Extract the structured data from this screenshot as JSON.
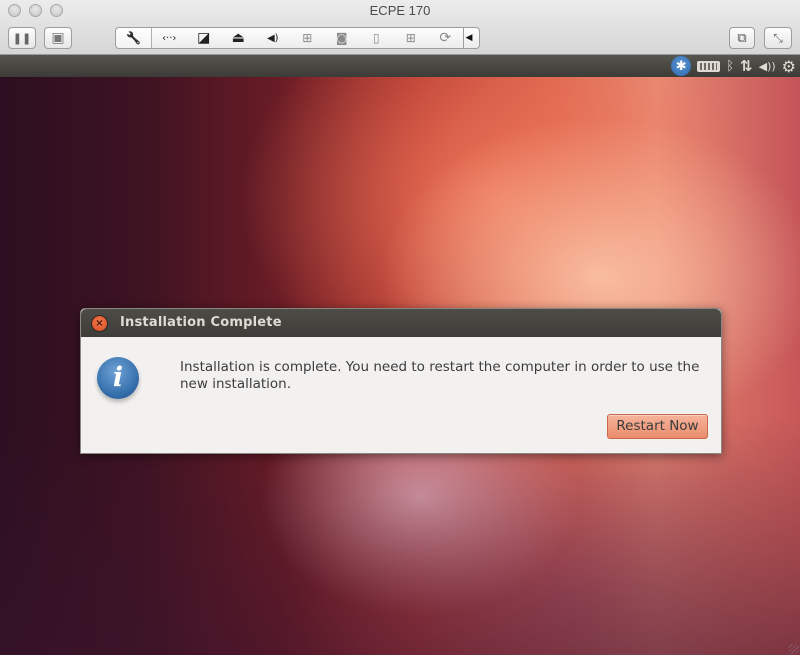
{
  "window": {
    "title": "ECPE 170",
    "traffic_lights": [
      "close",
      "minimize",
      "zoom"
    ]
  },
  "toolbar": {
    "left_buttons": [
      {
        "name": "pause-button",
        "icon": "pause-icon",
        "glyph": "❚❚"
      },
      {
        "name": "snapshot-button",
        "icon": "snapshot-icon",
        "glyph": "▣"
      }
    ],
    "device_group": [
      {
        "name": "settings-button",
        "icon": "wrench-icon",
        "glyph": "🔧",
        "dim": false
      },
      {
        "name": "network-button",
        "icon": "network-icon",
        "glyph": "‹··›",
        "dim": false
      },
      {
        "name": "harddisk-button",
        "icon": "harddisk-icon",
        "glyph": "◪",
        "dim": false
      },
      {
        "name": "cd-dvd-button",
        "icon": "disc-drive-icon",
        "glyph": "⏏",
        "dim": false
      },
      {
        "name": "sound-button",
        "icon": "speaker-icon",
        "glyph": "◀)",
        "dim": false
      },
      {
        "name": "usb-button",
        "icon": "usb-device-icon",
        "glyph": "⊞",
        "dim": true
      },
      {
        "name": "camera-button",
        "icon": "camera-icon",
        "glyph": "◙",
        "dim": true
      },
      {
        "name": "mouse-button",
        "icon": "mouse-icon",
        "glyph": "▯",
        "dim": true
      },
      {
        "name": "printer-button",
        "icon": "printer-icon",
        "glyph": "⊞",
        "dim": true
      },
      {
        "name": "sync-button",
        "icon": "sync-icon",
        "glyph": "⟳",
        "dim": true
      }
    ],
    "collapse_glyph": "◀",
    "right_buttons": [
      {
        "name": "unity-mode-button",
        "icon": "windows-icon",
        "glyph": "⧉"
      },
      {
        "name": "fullscreen-button",
        "icon": "fullscreen-icon",
        "glyph": "⤡"
      }
    ]
  },
  "panel": {
    "indicators": [
      {
        "name": "accessibility-indicator",
        "icon": "accessibility-icon",
        "glyph": "✱"
      },
      {
        "name": "keyboard-indicator",
        "icon": "keyboard-icon",
        "glyph": ""
      },
      {
        "name": "bluetooth-indicator",
        "icon": "bluetooth-icon",
        "glyph": "ᛒ"
      },
      {
        "name": "network-indicator",
        "icon": "network-updown-icon",
        "glyph": "⇅"
      },
      {
        "name": "volume-indicator",
        "icon": "volume-icon",
        "glyph": "◀))"
      },
      {
        "name": "session-indicator",
        "icon": "gear-power-icon",
        "glyph": "⚙"
      }
    ]
  },
  "dialog": {
    "title": "Installation Complete",
    "close_glyph": "×",
    "info_glyph": "i",
    "message": "Installation is complete. You need to restart the computer in order to use the new installation.",
    "button_label": "Restart Now"
  },
  "colors": {
    "panel": "#3c3b37",
    "dialog_titlebar": "#3d3c38",
    "dialog_body": "#f2f1f0",
    "button_accent": "#ea8d6c",
    "close_button": "#e35d30",
    "info_blue": "#2f6aa6"
  }
}
